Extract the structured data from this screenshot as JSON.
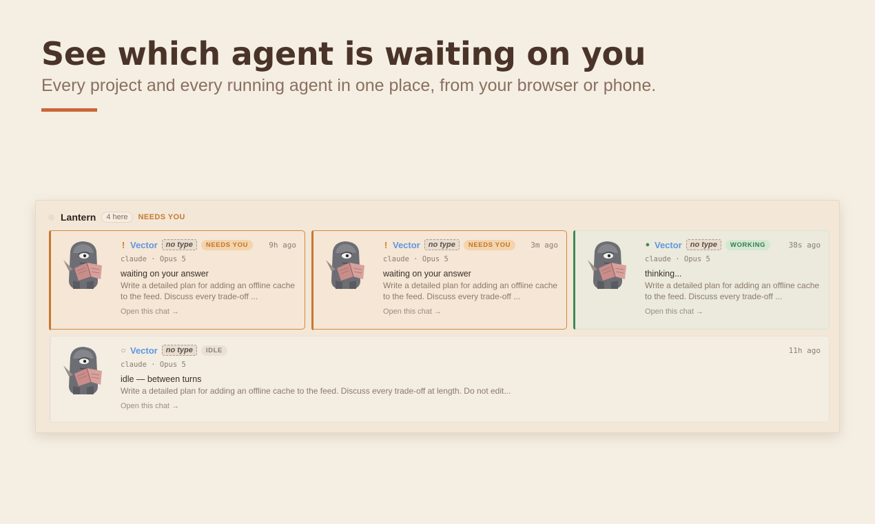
{
  "hero": {
    "title": "See which agent is waiting on you",
    "subtitle": "Every project and every running agent in one place, from your browser or phone."
  },
  "colors": {
    "accent": "#c9673a",
    "needs": "#d38a3e",
    "working": "#3e8a57",
    "agent_link": "#5e97e0"
  },
  "group": {
    "name": "Lantern",
    "count": "4 here",
    "flag": "NEEDS YOU"
  },
  "cards": [
    {
      "status": "needs",
      "glyph": "!",
      "agent": "Vector",
      "type": "no type",
      "badge": "NEEDS YOU",
      "time": "9h ago",
      "model": "claude · Opus 5",
      "state": "waiting on your answer",
      "desc": "Write a detailed plan for adding an offline cache to the feed. Discuss every trade-off ...",
      "open": "Open this chat →"
    },
    {
      "status": "needs",
      "glyph": "!",
      "agent": "Vector",
      "type": "no type",
      "badge": "NEEDS YOU",
      "time": "3m ago",
      "model": "claude · Opus 5",
      "state": "waiting on your answer",
      "desc": "Write a detailed plan for adding an offline cache to the feed. Discuss every trade-off ...",
      "open": "Open this chat →"
    },
    {
      "status": "working",
      "glyph": "●",
      "agent": "Vector",
      "type": "no type",
      "badge": "WORKING",
      "time": "38s ago",
      "model": "claude · Opus 5",
      "state": "thinking...",
      "desc": "Write a detailed plan for adding an offline cache to the feed. Discuss every trade-off ...",
      "open": "Open this chat →"
    },
    {
      "status": "idle",
      "glyph": "○",
      "agent": "Vector",
      "type": "no type",
      "badge": "IDLE",
      "time": "11h ago",
      "model": "claude · Opus 5",
      "state": "idle — between turns",
      "desc": "Write a detailed plan for adding an offline cache to the feed. Discuss every trade-off at length. Do not edit...",
      "open": "Open this chat →"
    }
  ]
}
